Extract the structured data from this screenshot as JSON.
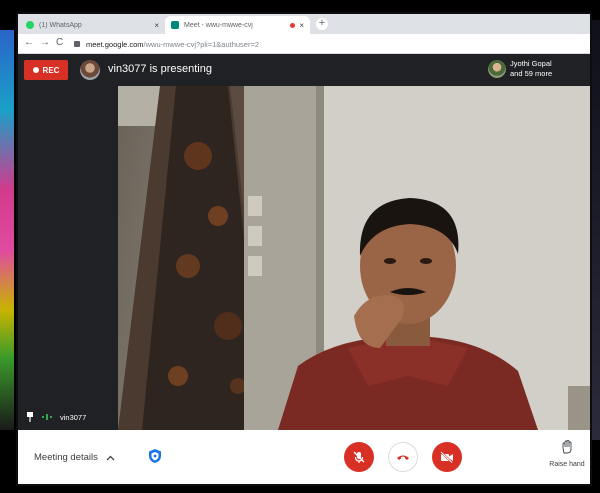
{
  "browser": {
    "tabs": [
      {
        "title": "(1) WhatsApp",
        "active": false,
        "favicon_color": "#25d366"
      },
      {
        "title": "Meet - wwu-mwwe-cvj",
        "active": true,
        "favicon_color": "#00897b",
        "recording": true
      }
    ],
    "tab_close_glyph": "×",
    "new_tab_glyph": "+",
    "nav": {
      "back": "←",
      "forward": "→",
      "reload": "C"
    },
    "url_host": "meet.google.com",
    "url_path": "/wwu-mwwe-cvj?pli=1&authuser=2"
  },
  "meet": {
    "rec_label": "REC",
    "presenting_text": "vin3077 is presenting",
    "participants_line1": "Jyothi Gopal",
    "participants_line2": "and 59 more",
    "self_name": "vin3077",
    "meeting_details": "Meeting details",
    "raise_hand": "Raise hand"
  },
  "colors": {
    "rec_red": "#d93025",
    "bar_dark": "#202124",
    "accent_blue": "#1a73e8"
  },
  "icons": [
    "pin-icon",
    "audio-level-icon",
    "chevron-up-icon",
    "shield-icon",
    "mic-off-icon",
    "call-end-icon",
    "camera-off-icon",
    "hand-icon",
    "lock-icon"
  ]
}
